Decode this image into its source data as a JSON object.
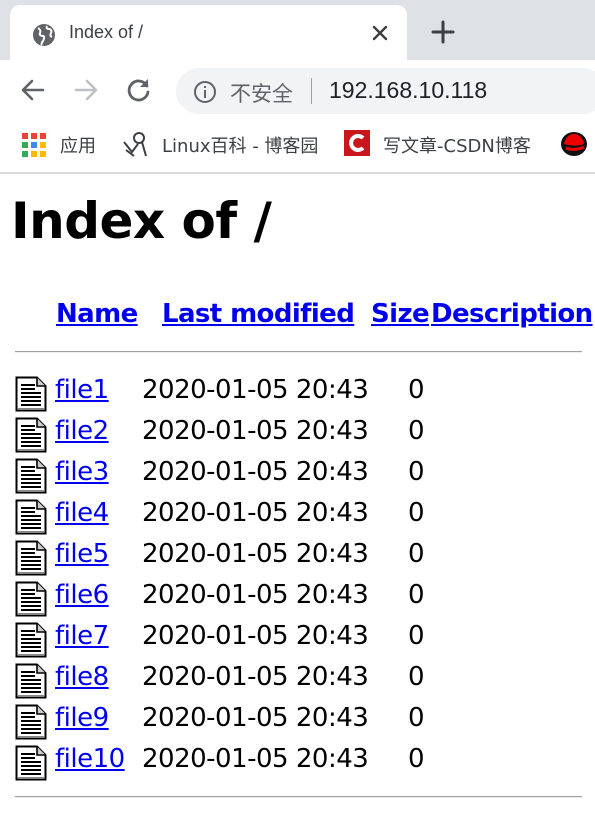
{
  "browser": {
    "tab": {
      "title": "Index of /",
      "favicon": "globe-icon",
      "close_glyph": "✕"
    },
    "new_tab_icon": "plus-icon",
    "nav": {
      "back_icon": "arrow-left-icon",
      "forward_icon": "arrow-right-icon",
      "reload_icon": "reload-icon"
    },
    "omnibox": {
      "security_icon": "info-icon",
      "security_label": "不安全",
      "url": "192.168.10.118"
    },
    "bookmarks": [
      {
        "label": "应用",
        "icon": "apps-grid-icon"
      },
      {
        "label": "Linux百科 - 博客园",
        "icon": "cnblogs-icon"
      },
      {
        "label": "写文章-CSDN博客",
        "icon": "csdn-icon"
      },
      {
        "label": "",
        "icon": "redhat-icon"
      }
    ]
  },
  "page": {
    "heading": "Index of /",
    "columns": {
      "name": "Name",
      "last_modified": "Last modified",
      "size": "Size",
      "description": "Description"
    },
    "files": [
      {
        "name": "file1",
        "modified": "2020-01-05 20:43",
        "size": "0",
        "description": ""
      },
      {
        "name": "file2",
        "modified": "2020-01-05 20:43",
        "size": "0",
        "description": ""
      },
      {
        "name": "file3",
        "modified": "2020-01-05 20:43",
        "size": "0",
        "description": ""
      },
      {
        "name": "file4",
        "modified": "2020-01-05 20:43",
        "size": "0",
        "description": ""
      },
      {
        "name": "file5",
        "modified": "2020-01-05 20:43",
        "size": "0",
        "description": ""
      },
      {
        "name": "file6",
        "modified": "2020-01-05 20:43",
        "size": "0",
        "description": ""
      },
      {
        "name": "file7",
        "modified": "2020-01-05 20:43",
        "size": "0",
        "description": ""
      },
      {
        "name": "file8",
        "modified": "2020-01-05 20:43",
        "size": "0",
        "description": ""
      },
      {
        "name": "file9",
        "modified": "2020-01-05 20:43",
        "size": "0",
        "description": ""
      },
      {
        "name": "file10",
        "modified": "2020-01-05 20:43",
        "size": "0",
        "description": ""
      }
    ],
    "link_color": "#0000ee"
  }
}
